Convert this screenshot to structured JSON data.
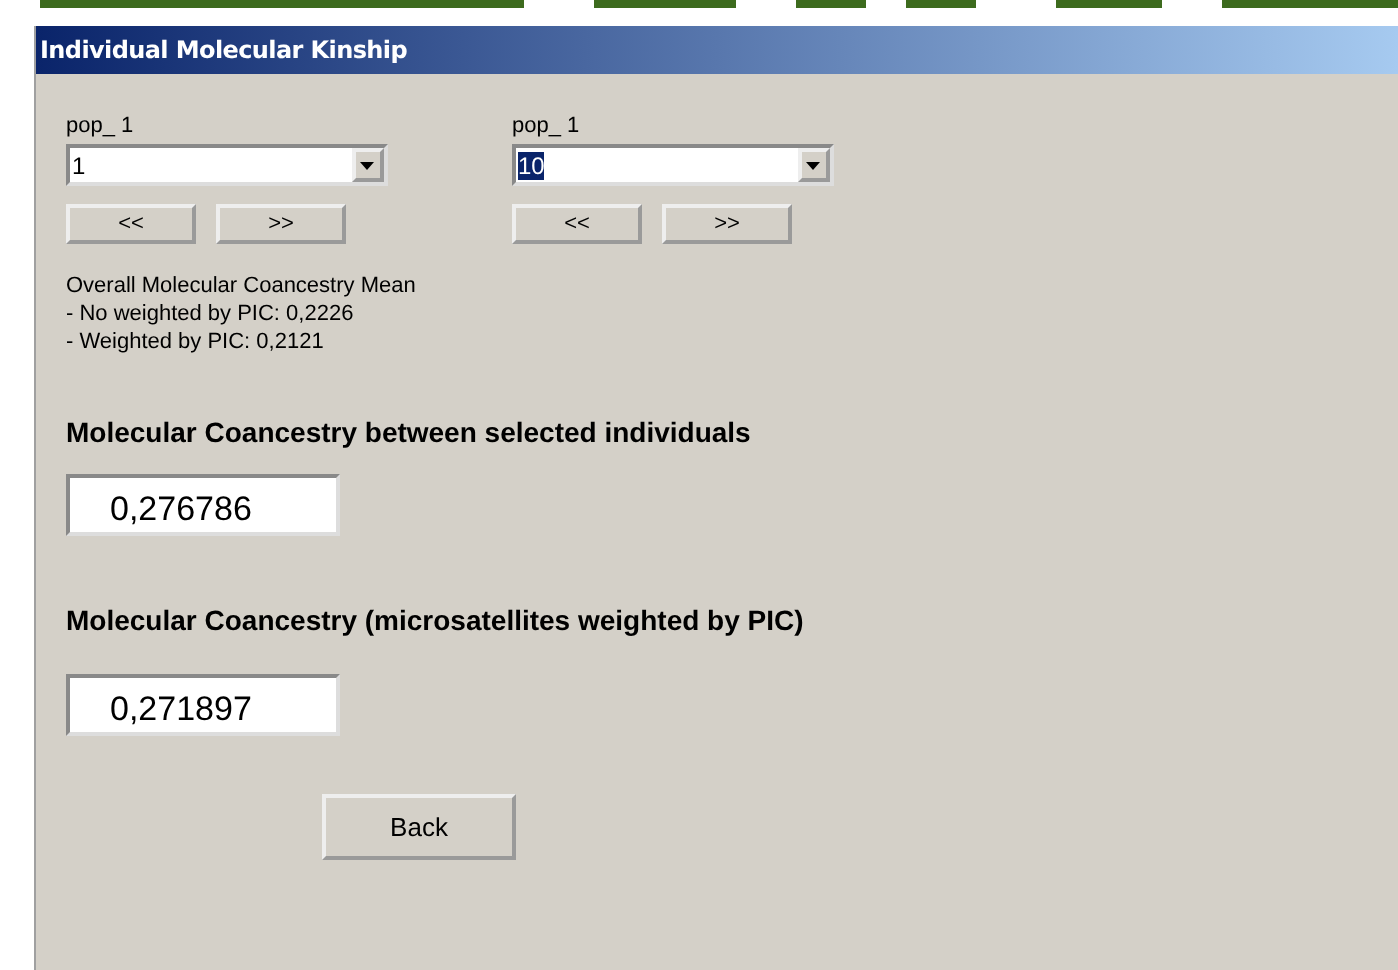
{
  "window": {
    "title": "Individual Molecular Kinship"
  },
  "selectors": [
    {
      "label": "pop_ 1",
      "value": "1",
      "highlighted": false,
      "prev": "<<",
      "next": ">>"
    },
    {
      "label": "pop_ 1",
      "value": "10",
      "highlighted": true,
      "prev": "<<",
      "next": ">>"
    }
  ],
  "summary": [
    "Overall Molecular Coancestry Mean",
    "- No weighted by PIC:  0,2226",
    "- Weighted by PIC:  0,2121"
  ],
  "results": [
    {
      "heading": "Molecular Coancestry between selected individuals",
      "value": "0,276786"
    },
    {
      "heading": "Molecular Coancestry (microsatellites weighted by PIC)",
      "value": "0,271897"
    }
  ],
  "back_button": "Back"
}
